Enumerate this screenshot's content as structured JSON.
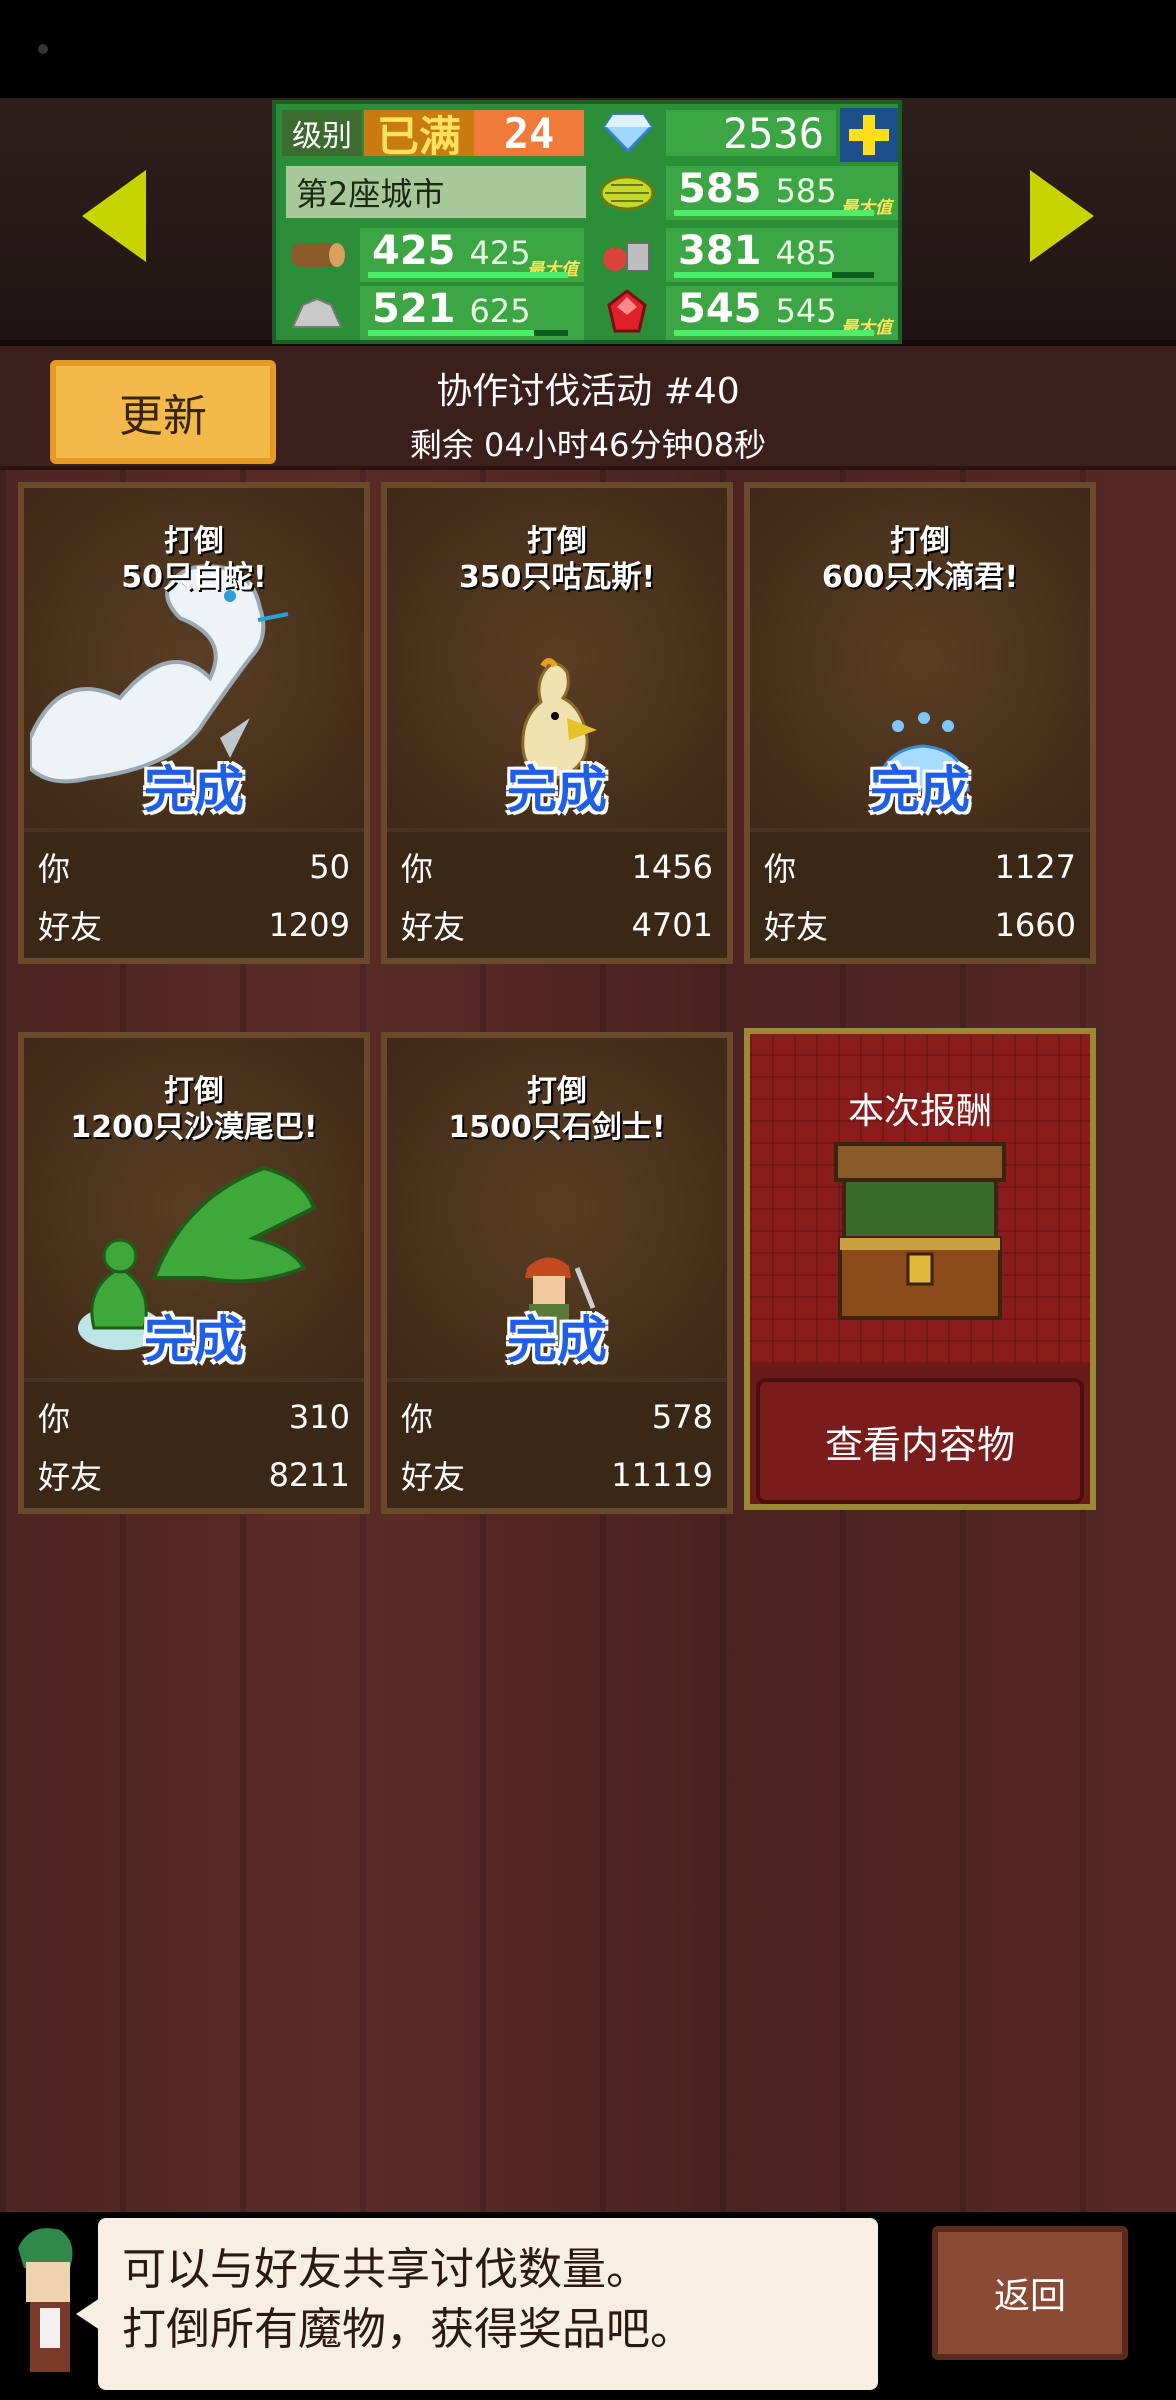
{
  "header": {
    "level_label": "级别",
    "level_max": "已满",
    "level": "24",
    "gems": "2536",
    "city": "第2座城市",
    "resources": [
      {
        "icon": "wood-icon",
        "value": "425",
        "max": "425",
        "tag": "最大值",
        "fill": 1.0
      },
      {
        "icon": "stone-icon",
        "value": "521",
        "max": "625",
        "tag": "",
        "fill": 0.83
      },
      {
        "icon": "crop-icon",
        "value": "585",
        "max": "585",
        "tag": "最大值",
        "fill": 1.0
      },
      {
        "icon": "food-icon",
        "value": "381",
        "max": "485",
        "tag": "",
        "fill": 0.79
      },
      {
        "icon": "ruby-icon",
        "value": "545",
        "max": "545",
        "tag": "最大值",
        "fill": 1.0
      }
    ],
    "colors": {
      "accent": "#c8d400",
      "panel": "#2b8f3a"
    }
  },
  "event": {
    "refresh_label": "更新",
    "title": "协作讨伐活动 #40",
    "time_left": "剩余 04小时46分钟08秒"
  },
  "cards": [
    {
      "verb": "打倒",
      "target": "50只白蛇!",
      "status": "完成",
      "you_label": "你",
      "you": "50",
      "friend_label": "好友",
      "friend": "1209",
      "icon": "white-snake-icon"
    },
    {
      "verb": "打倒",
      "target": "350只咕瓦斯!",
      "status": "完成",
      "you_label": "你",
      "you": "1456",
      "friend_label": "好友",
      "friend": "4701",
      "icon": "chicken-icon"
    },
    {
      "verb": "打倒",
      "target": "600只水滴君!",
      "status": "完成",
      "you_label": "你",
      "you": "1127",
      "friend_label": "好友",
      "friend": "1660",
      "icon": "slime-icon"
    },
    {
      "verb": "打倒",
      "target": "1200只沙漠尾巴!",
      "status": "完成",
      "you_label": "你",
      "you": "310",
      "friend_label": "好友",
      "friend": "8211",
      "icon": "plant-icon"
    },
    {
      "verb": "打倒",
      "target": "1500只石剑士!",
      "status": "完成",
      "you_label": "你",
      "you": "578",
      "friend_label": "好友",
      "friend": "11119",
      "icon": "swordsman-icon"
    }
  ],
  "reward": {
    "title": "本次报酬",
    "view_label": "查看内容物"
  },
  "footer": {
    "message_line1": "可以与好友共享讨伐数量。",
    "message_line2": "打倒所有魔物，获得奖品吧。",
    "back_label": "返回"
  }
}
